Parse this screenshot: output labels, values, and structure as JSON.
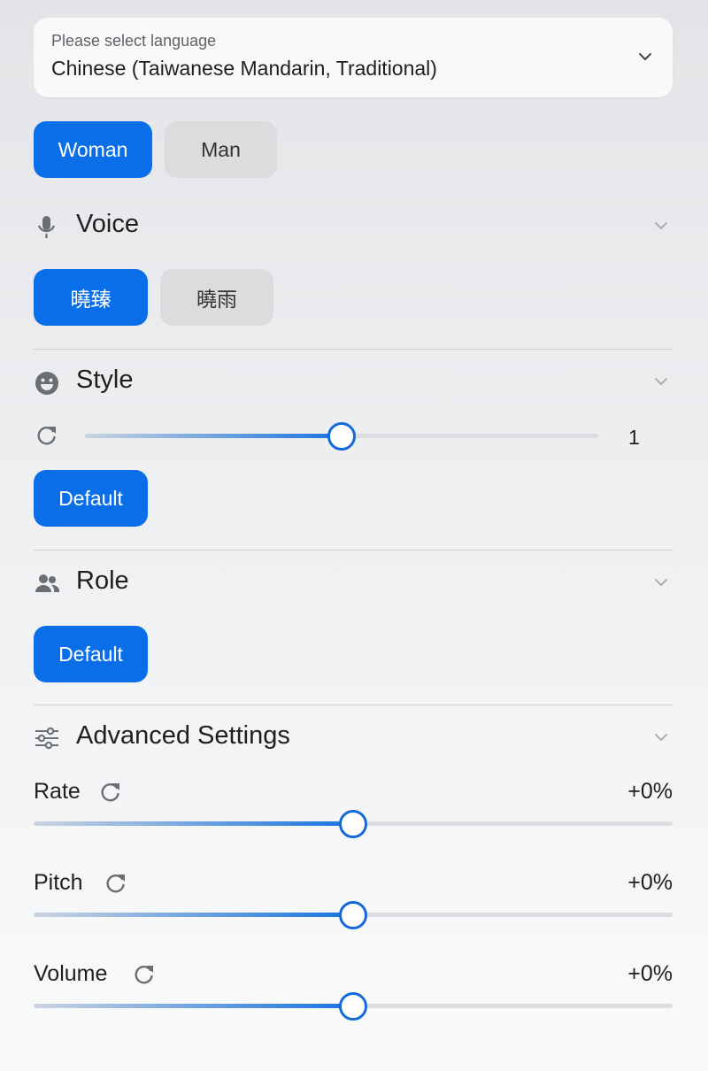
{
  "language": {
    "caption": "Please select language",
    "selected": "Chinese (Taiwanese Mandarin, Traditional)"
  },
  "gender": {
    "options": [
      "Woman",
      "Man"
    ],
    "selected": "Woman"
  },
  "voice": {
    "title": "Voice",
    "options": [
      "曉臻",
      "曉雨"
    ],
    "selected": "曉臻"
  },
  "style": {
    "title": "Style",
    "degree": {
      "value": "1",
      "fraction": 0.5
    },
    "options": [
      "Default"
    ],
    "selected": "Default"
  },
  "role": {
    "title": "Role",
    "options": [
      "Default"
    ],
    "selected": "Default"
  },
  "advanced": {
    "title": "Advanced Settings",
    "rate": {
      "label": "Rate",
      "value": "+0%",
      "fraction": 0.5
    },
    "pitch": {
      "label": "Pitch",
      "value": "+0%",
      "fraction": 0.5
    },
    "volume": {
      "label": "Volume",
      "value": "+0%",
      "fraction": 0.5
    }
  },
  "colors": {
    "accent": "#0a6ee8",
    "inactive_button": "#dcdcdf"
  }
}
